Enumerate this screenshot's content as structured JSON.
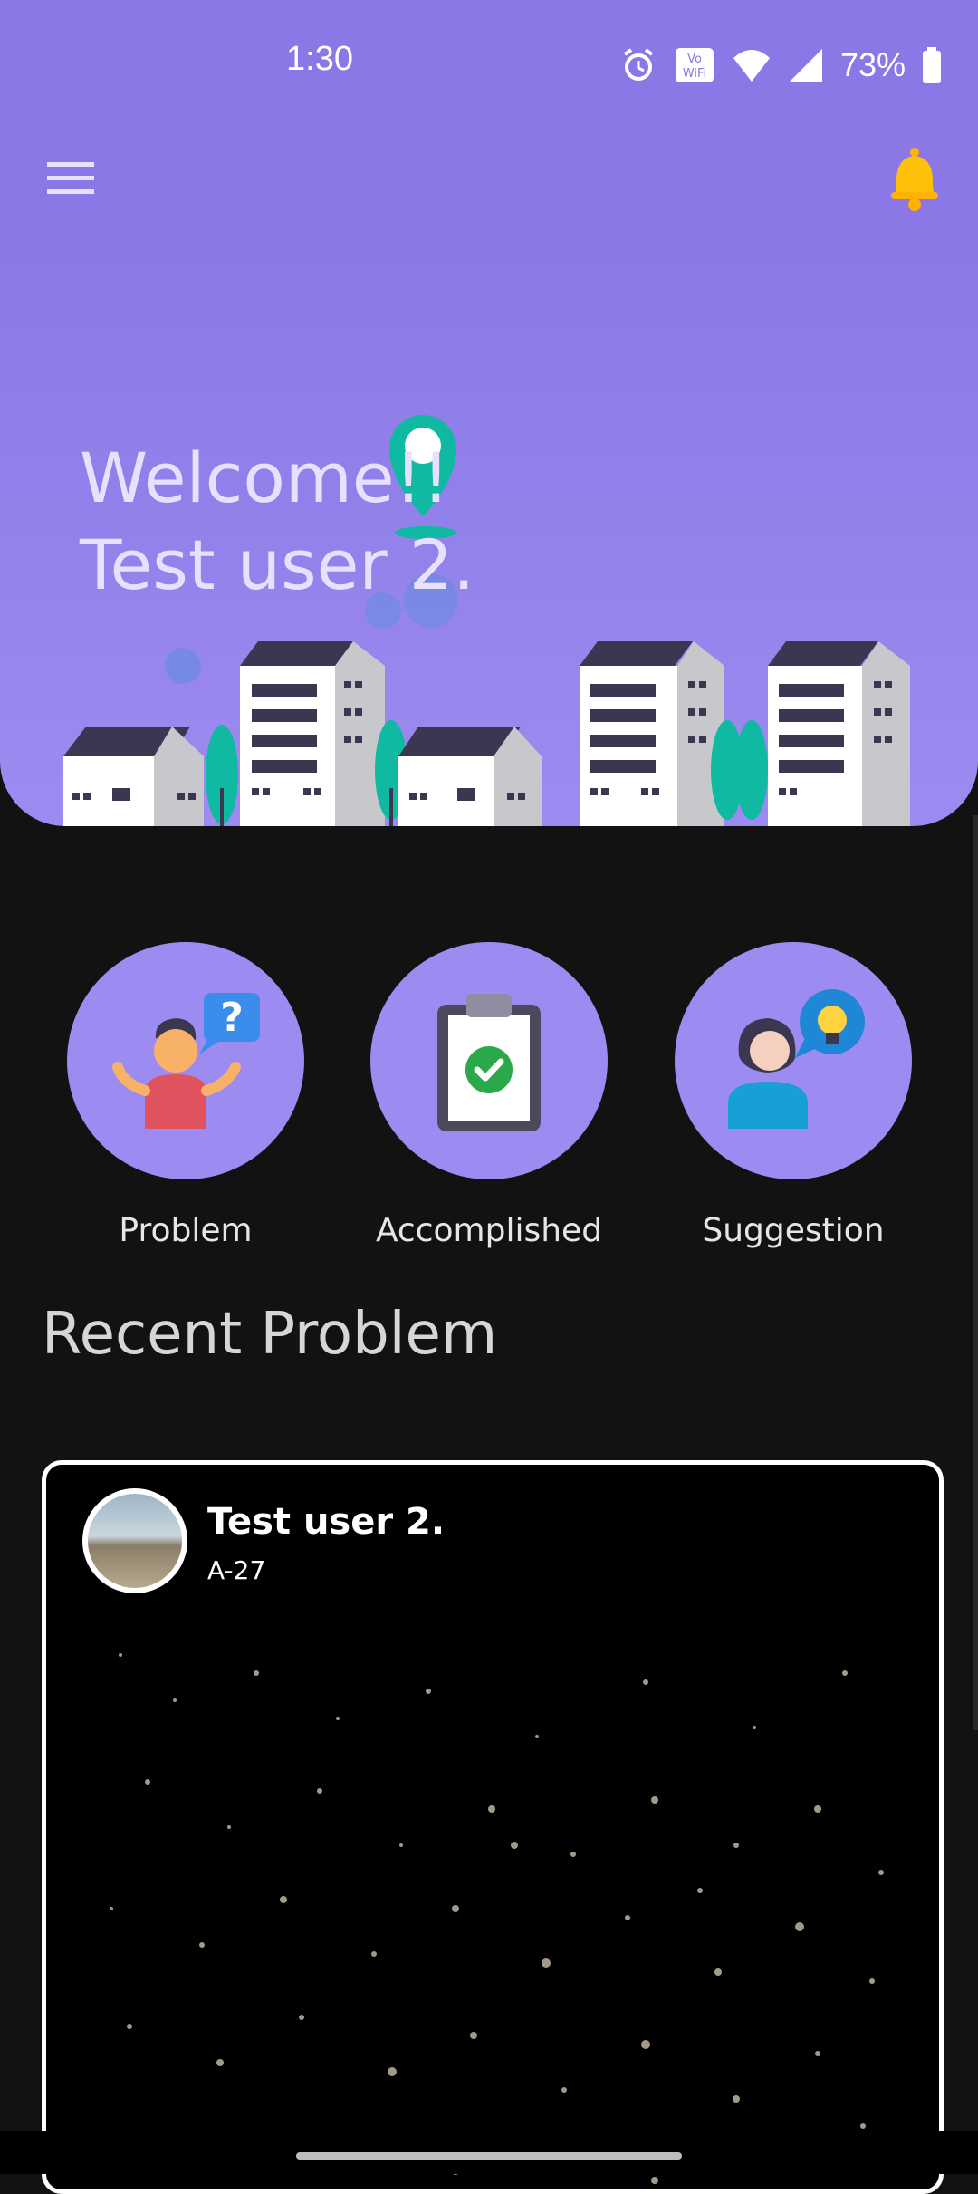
{
  "status": {
    "time": "1:30",
    "battery": "73%",
    "icons": [
      "alarm-icon",
      "vowifi-icon",
      "wifi-icon",
      "signal-icon",
      "battery-icon"
    ]
  },
  "appbar": {
    "menu_icon": "hamburger-menu-icon",
    "bell_icon": "bell-icon"
  },
  "hero": {
    "line1": "Welcome!!",
    "line2": "Test user 2."
  },
  "categories": [
    {
      "label": "Problem",
      "icon": "confused-person-icon"
    },
    {
      "label": "Accomplished",
      "icon": "clipboard-check-icon"
    },
    {
      "label": "Suggestion",
      "icon": "idea-person-icon"
    }
  ],
  "recent": {
    "title": "Recent Problem",
    "card": {
      "user": "Test user 2.",
      "sub": "A-27"
    }
  },
  "colors": {
    "primary": "#8B78E6",
    "hero_bottom": "#9C8BF0",
    "background": "#121212",
    "accent_teal": "#10B9A2",
    "bell": "#FFC107"
  }
}
